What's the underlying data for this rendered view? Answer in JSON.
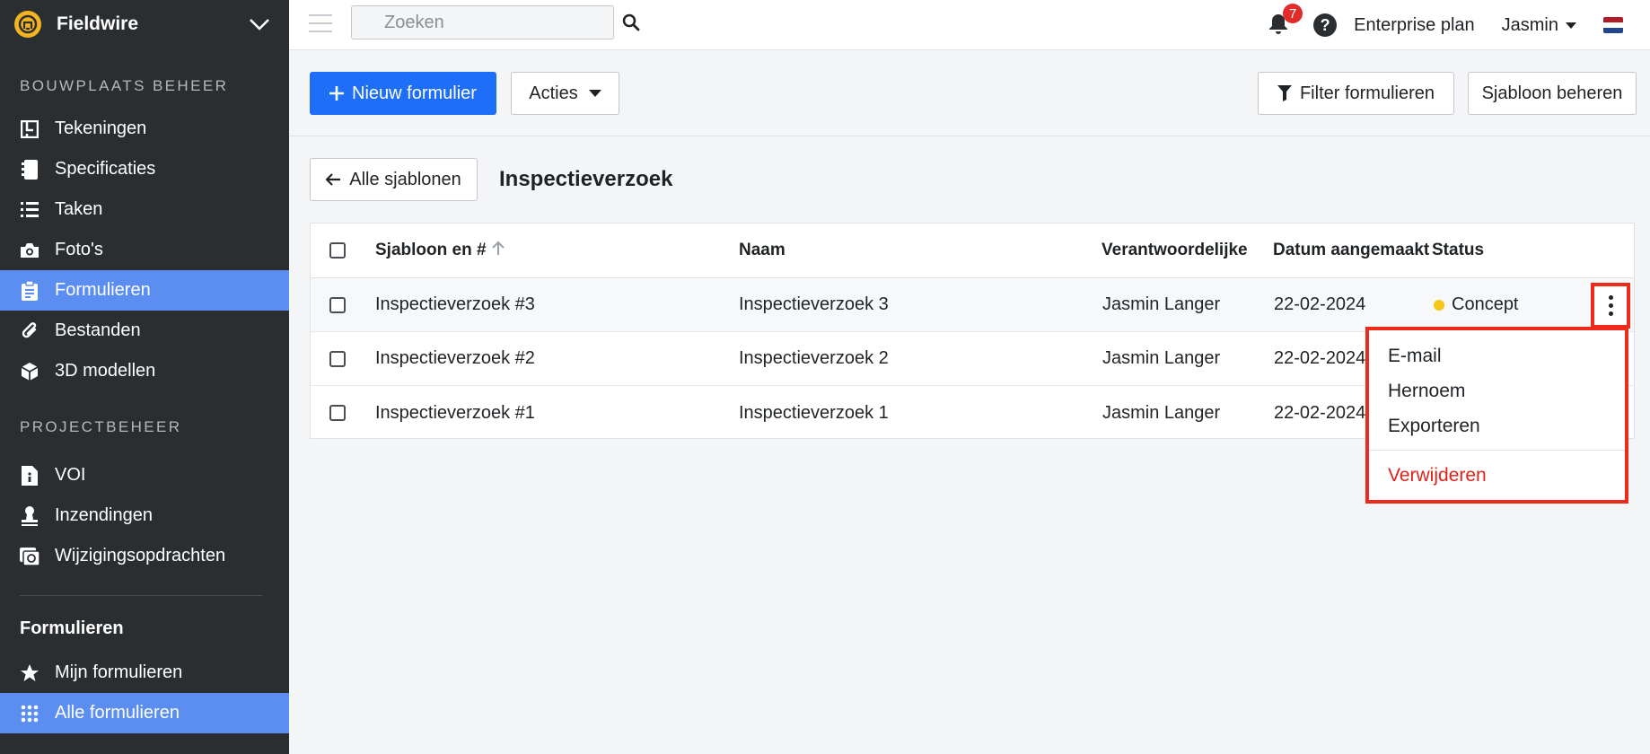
{
  "app": {
    "name": "Fieldwire"
  },
  "sidebar": {
    "section1_title": "BOUWPLAATS BEHEER",
    "section1_items": [
      {
        "label": "Tekeningen",
        "icon": "drawings-icon"
      },
      {
        "label": "Specificaties",
        "icon": "specs-icon"
      },
      {
        "label": "Taken",
        "icon": "list-icon"
      },
      {
        "label": "Foto's",
        "icon": "camera-icon"
      },
      {
        "label": "Formulieren",
        "icon": "clipboard-icon",
        "active": true
      },
      {
        "label": "Bestanden",
        "icon": "paperclip-icon"
      },
      {
        "label": "3D modellen",
        "icon": "cube-icon"
      }
    ],
    "section2_title": "PROJECTBEHEER",
    "section2_items": [
      {
        "label": "VOI",
        "icon": "info-doc-icon"
      },
      {
        "label": "Inzendingen",
        "icon": "stamp-icon"
      },
      {
        "label": "Wijzigingsopdrachten",
        "icon": "change-order-icon"
      }
    ],
    "sub_title": "Formulieren",
    "sub_items": [
      {
        "label": "Mijn formulieren",
        "icon": "star-icon"
      },
      {
        "label": "Alle formulieren",
        "icon": "grid-icon",
        "active": true
      }
    ]
  },
  "topbar": {
    "search_placeholder": "Zoeken",
    "notifications_count": "7",
    "help_label": "?",
    "plan": "Enterprise plan",
    "user": "Jasmin"
  },
  "toolbar": {
    "new_form_label": "Nieuw formulier",
    "actions_label": "Acties",
    "filter_label": "Filter formulieren",
    "manage_template_label": "Sjabloon beheren"
  },
  "header": {
    "back_label": "Alle sjablonen",
    "title": "Inspectieverzoek"
  },
  "table": {
    "columns": [
      "Sjabloon en #",
      "Naam",
      "Verantwoordelijke",
      "Datum aangemaakt",
      "Status"
    ],
    "rows": [
      {
        "template": "Inspectieverzoek #3",
        "name": "Inspectieverzoek 3",
        "owner": "Jasmin Langer",
        "date": "22-02-2024",
        "status": "Concept"
      },
      {
        "template": "Inspectieverzoek #2",
        "name": "Inspectieverzoek 2",
        "owner": "Jasmin Langer",
        "date": "22-02-2024",
        "status": ""
      },
      {
        "template": "Inspectieverzoek #1",
        "name": "Inspectieverzoek 1",
        "owner": "Jasmin Langer",
        "date": "22-02-2024",
        "status": ""
      }
    ]
  },
  "row_menu": {
    "email": "E-mail",
    "rename": "Hernoem",
    "export": "Exporteren",
    "delete": "Verwijderen"
  },
  "colors": {
    "sidebar_bg": "#2b2e31",
    "active_nav": "#5b8ef0",
    "primary": "#1f6ef8",
    "highlight": "#ee2b1a",
    "danger": "#e0231b",
    "status_concept": "#f5c518"
  }
}
